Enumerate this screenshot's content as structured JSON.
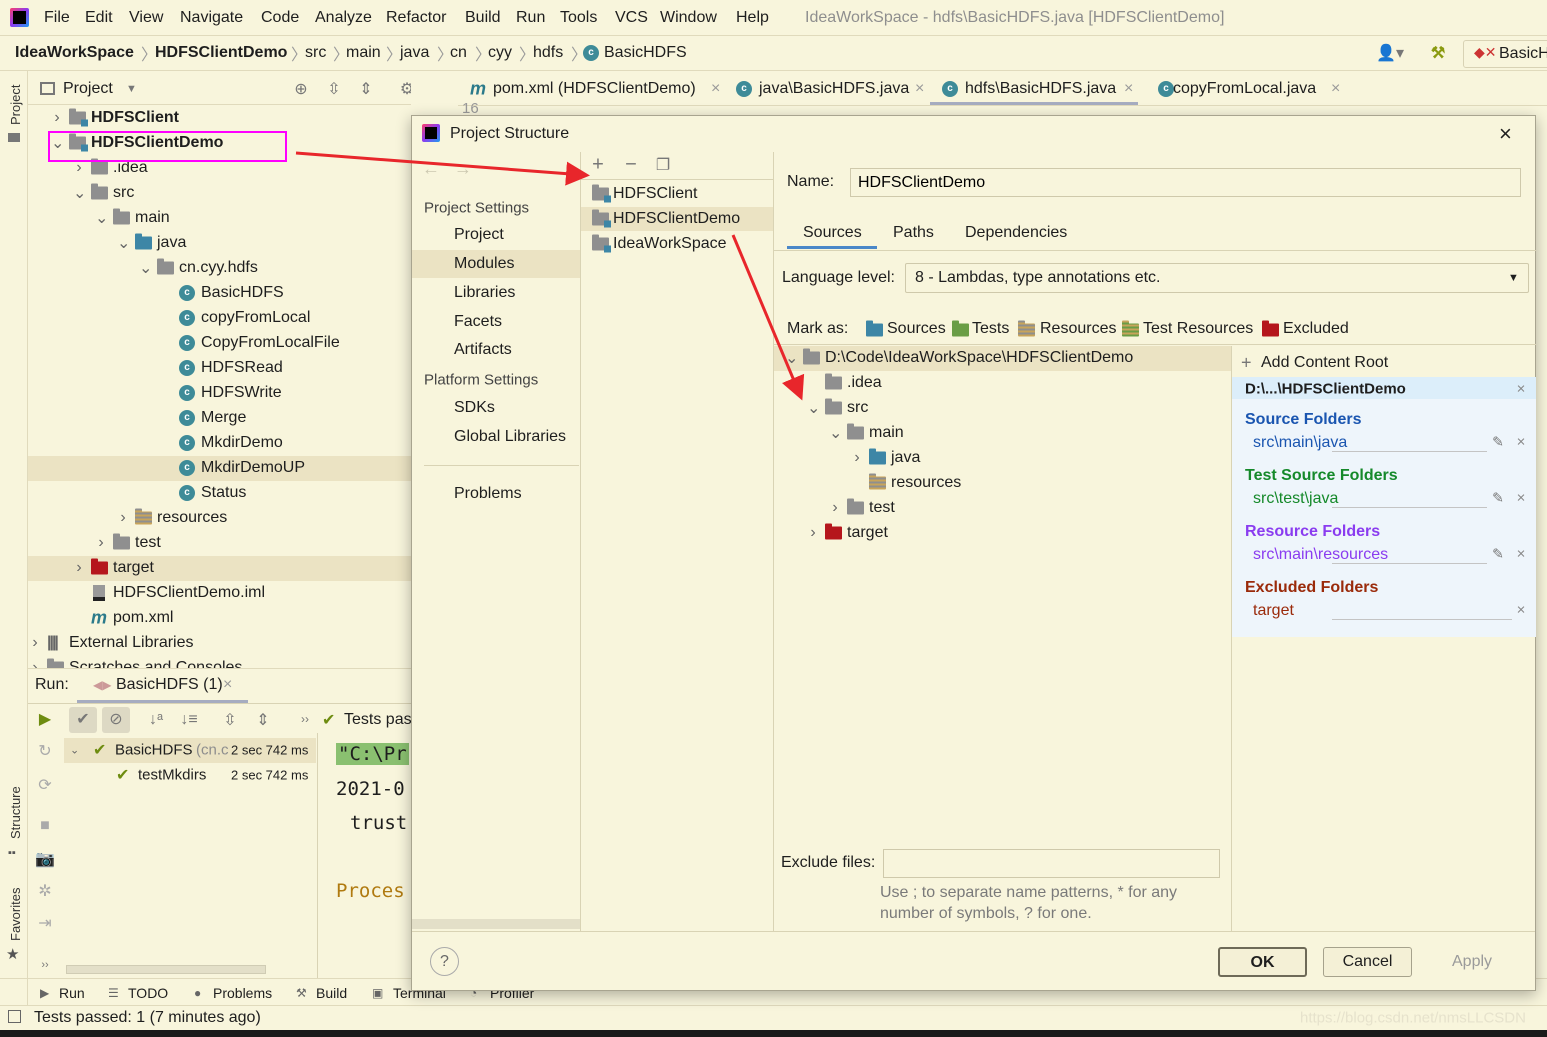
{
  "menubar": {
    "items": [
      "File",
      "Edit",
      "View",
      "Navigate",
      "Code",
      "Analyze",
      "Refactor",
      "Build",
      "Run",
      "Tools",
      "VCS",
      "Window",
      "Help"
    ],
    "window_title": "IdeaWorkSpace - hdfs\\BasicHDFS.java [HDFSClientDemo]"
  },
  "breadcrumb": {
    "items": [
      "IdeaWorkSpace",
      "HDFSClientDemo",
      "src",
      "main",
      "java",
      "cn",
      "cyy",
      "hdfs",
      "BasicHDFS"
    ],
    "run_config": "BasicH"
  },
  "tool_strip": {
    "project": "Project",
    "structure": "Structure",
    "favorites": "Favorites"
  },
  "project_panel": {
    "title": "Project",
    "tree": [
      {
        "label": "HDFSClient",
        "level": 1,
        "exp": "c",
        "icon": "mod",
        "bold": true
      },
      {
        "label": "HDFSClientDemo",
        "level": 1,
        "exp": "o",
        "icon": "mod",
        "bold": true
      },
      {
        "label": ".idea",
        "level": 2,
        "exp": "c",
        "icon": "folder"
      },
      {
        "label": "src",
        "level": 2,
        "exp": "o",
        "icon": "folder"
      },
      {
        "label": "main",
        "level": 3,
        "exp": "o",
        "icon": "folder"
      },
      {
        "label": "java",
        "level": 4,
        "exp": "o",
        "icon": "src"
      },
      {
        "label": "cn.cyy.hdfs",
        "level": 5,
        "exp": "o",
        "icon": "pkg"
      },
      {
        "label": "BasicHDFS",
        "level": 6,
        "icon": "class"
      },
      {
        "label": "copyFromLocal",
        "level": 6,
        "icon": "class"
      },
      {
        "label": "CopyFromLocalFile",
        "level": 6,
        "icon": "class"
      },
      {
        "label": "HDFSRead",
        "level": 6,
        "icon": "class"
      },
      {
        "label": "HDFSWrite",
        "level": 6,
        "icon": "class"
      },
      {
        "label": "Merge",
        "level": 6,
        "icon": "class"
      },
      {
        "label": "MkdirDemo",
        "level": 6,
        "icon": "class"
      },
      {
        "label": "MkdirDemoUP",
        "level": 6,
        "icon": "class",
        "selected": true
      },
      {
        "label": "Status",
        "level": 6,
        "icon": "class"
      },
      {
        "label": "resources",
        "level": 4,
        "exp": "c",
        "icon": "res"
      },
      {
        "label": "test",
        "level": 3,
        "exp": "c",
        "icon": "folder"
      },
      {
        "label": "target",
        "level": 2,
        "exp": "c",
        "icon": "exc",
        "selected": true
      },
      {
        "label": "HDFSClientDemo.iml",
        "level": 2,
        "icon": "iml"
      },
      {
        "label": "pom.xml",
        "level": 2,
        "icon": "pom"
      },
      {
        "label": "External Libraries",
        "level": 0,
        "exp": "c",
        "icon": "libs"
      },
      {
        "label": "Scratches and Consoles",
        "level": 0,
        "exp": "c",
        "icon": "folder"
      }
    ]
  },
  "editor_tabs": [
    {
      "label": "pom.xml (HDFSClientDemo)",
      "icon": "maven"
    },
    {
      "label": "java\\BasicHDFS.java",
      "icon": "class"
    },
    {
      "label": "hdfs\\BasicHDFS.java",
      "icon": "class",
      "active": true
    },
    {
      "label": "copyFromLocal.java",
      "icon": "class"
    }
  ],
  "dialog": {
    "title": "Project Structure",
    "nav": {
      "project_settings": "Project Settings",
      "items1": [
        "Project",
        "Modules",
        "Libraries",
        "Facets",
        "Artifacts"
      ],
      "platform_settings": "Platform Settings",
      "items2": [
        "SDKs",
        "Global Libraries"
      ],
      "problems": "Problems",
      "selected": "Modules"
    },
    "modules": [
      {
        "label": "HDFSClient"
      },
      {
        "label": "HDFSClientDemo",
        "selected": true
      },
      {
        "label": "IdeaWorkSpace"
      }
    ],
    "name_label": "Name:",
    "name_value": "HDFSClientDemo",
    "tabs": [
      "Sources",
      "Paths",
      "Dependencies"
    ],
    "active_tab": "Sources",
    "language_level_label": "Language level:",
    "language_level_value": "8 - Lambdas, type annotations etc.",
    "mark_as_label": "Mark as:",
    "mark_as": [
      {
        "label": "Sources",
        "icon": "src"
      },
      {
        "label": "Tests",
        "icon": "test"
      },
      {
        "label": "Resources",
        "icon": "res"
      },
      {
        "label": "Test Resources",
        "icon": "tres"
      },
      {
        "label": "Excluded",
        "icon": "exc"
      }
    ],
    "content_tree": [
      {
        "label": "D:\\Code\\IdeaWorkSpace\\HDFSClientDemo",
        "level": 0,
        "exp": "o",
        "icon": "folder",
        "selected": true
      },
      {
        "label": ".idea",
        "level": 1,
        "icon": "folder"
      },
      {
        "label": "src",
        "level": 1,
        "exp": "o",
        "icon": "folder"
      },
      {
        "label": "main",
        "level": 2,
        "exp": "o",
        "icon": "folder"
      },
      {
        "label": "java",
        "level": 3,
        "exp": "c",
        "icon": "src"
      },
      {
        "label": "resources",
        "level": 3,
        "icon": "res"
      },
      {
        "label": "test",
        "level": 2,
        "exp": "c",
        "icon": "folder"
      },
      {
        "label": "target",
        "level": 1,
        "exp": "c",
        "icon": "exc"
      }
    ],
    "add_content_root": "Add Content Root",
    "content_root": "D:\\...\\HDFSClientDemo",
    "folder_groups": [
      {
        "title": "Source Folders",
        "path": "src\\main\\java",
        "color": "#1a55b0",
        "editable": true
      },
      {
        "title": "Test Source Folders",
        "path": "src\\test\\java",
        "color": "#15892a",
        "editable": true
      },
      {
        "title": "Resource Folders",
        "path": "src\\main\\resources",
        "color": "#8a3cf0",
        "editable": true
      },
      {
        "title": "Excluded Folders",
        "path": "target",
        "color": "#9a2a0a",
        "editable": false
      }
    ],
    "exclude_files_label": "Exclude files:",
    "exclude_files_value": "",
    "exclude_hint_1": "Use ; to separate name patterns, * for any",
    "exclude_hint_2": "number of symbols, ? for one.",
    "ok": "OK",
    "cancel": "Cancel",
    "apply": "Apply",
    "help": "?"
  },
  "run_panel": {
    "label": "Run:",
    "tab": "BasicHDFS (1)",
    "status_text": "Tests pas",
    "tests": [
      {
        "name": "BasicHDFS",
        "pkg": "(cn.c",
        "time": "2 sec 742 ms"
      },
      {
        "name": "testMkdirs",
        "time": "2 sec 742 ms"
      }
    ],
    "console": [
      "\"C:\\Pr",
      "2021-0",
      "trust",
      "Proces"
    ]
  },
  "bottom_tools": [
    "Run",
    "TODO",
    "Problems",
    "Build",
    "Terminal",
    "Profiler"
  ],
  "status_bar": "Tests passed: 1 (7 minutes ago)",
  "watermark": "https://blog.csdn.net/nmsLLCSDN",
  "colors": {
    "background": "#f8f5dc",
    "selection": "#ebe3c3",
    "annotation_red": "#e8262b",
    "highlight_box": "#ff00ff",
    "right_panel": "#eef5fb"
  }
}
